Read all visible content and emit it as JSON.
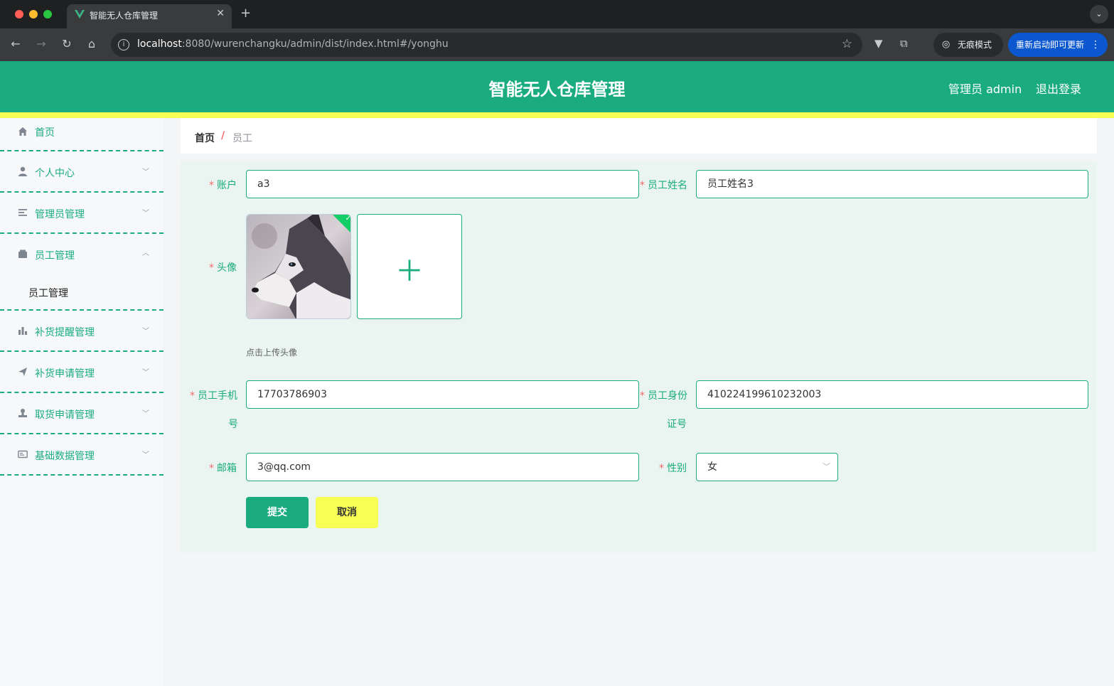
{
  "browser": {
    "tab_title": "智能无人仓库管理",
    "tab_close": "✕",
    "new_tab": "+",
    "url_host": "localhost",
    "url_path": ":8080/wurenchangku/admin/dist/index.html#/yonghu",
    "incognito_label": "无痕模式",
    "update_label": "重新启动即可更新"
  },
  "header": {
    "title": "智能无人仓库管理",
    "user_label": "管理员 admin",
    "logout_label": "退出登录"
  },
  "sidebar": {
    "items": [
      {
        "label": "首页",
        "icon": "home-icon"
      },
      {
        "label": "个人中心",
        "icon": "user-icon",
        "expanded": false
      },
      {
        "label": "管理员管理",
        "icon": "list-icon",
        "expanded": false
      },
      {
        "label": "员工管理",
        "icon": "wallet-icon",
        "expanded": true
      },
      {
        "label": "补货提醒管理",
        "icon": "bar-chart-icon",
        "expanded": false
      },
      {
        "label": "补货申请管理",
        "icon": "send-icon",
        "expanded": false
      },
      {
        "label": "取货申请管理",
        "icon": "stamp-icon",
        "expanded": false
      },
      {
        "label": "基础数据管理",
        "icon": "id-card-icon",
        "expanded": false
      }
    ],
    "submenu": {
      "label": "员工管理"
    }
  },
  "breadcrumb": {
    "home": "首页",
    "separator": "/",
    "current": "员工"
  },
  "form": {
    "account_label": "账户",
    "account_value": "a3",
    "name_label": "员工姓名",
    "name_value": "员工姓名3",
    "avatar_label": "头像",
    "upload_tip": "点击上传头像",
    "phone_label_1": "员工手机",
    "phone_label_2": "号",
    "phone_value": "17703786903",
    "id_label_1": "员工身份",
    "id_label_2": "证号",
    "id_value": "410224199610232003",
    "email_label": "邮箱",
    "email_value": "3@qq.com",
    "gender_label": "性别",
    "gender_value": "女",
    "required_mark": "*",
    "submit_label": "提交",
    "cancel_label": "取消"
  },
  "colors": {
    "primary": "#1aac7e",
    "accent_yellow": "#f7ff55",
    "required": "#f56c6c",
    "form_bg": "#eaf4f0"
  }
}
